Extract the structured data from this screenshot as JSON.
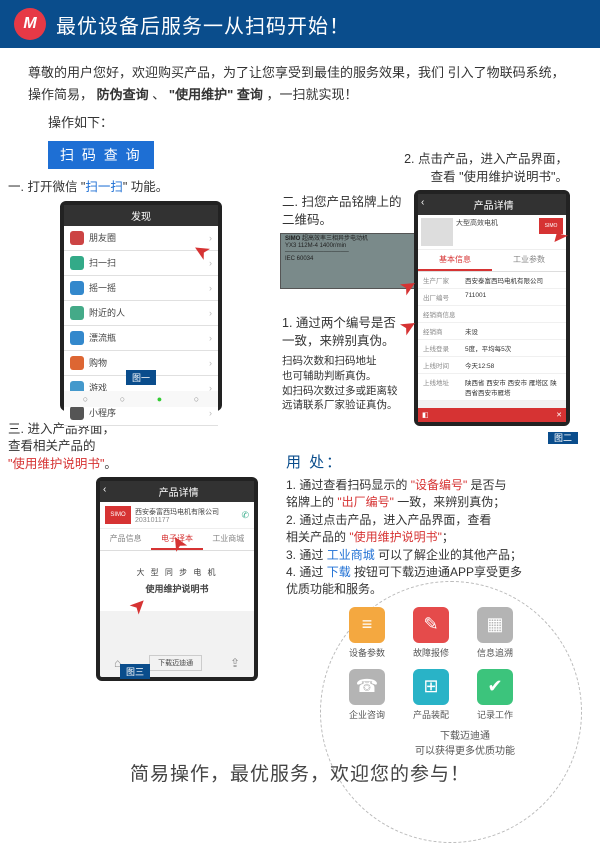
{
  "banner": {
    "logo_letter": "M",
    "title": "最优设备后服务一从扫码开始！"
  },
  "intro": {
    "line1_a": "尊敬的用户您好，欢迎购买产品，为了让您享受到最佳的服务效果，我们",
    "line1_b": "引入了物联码系统，操作简易，",
    "hl1": "防伪查询",
    "sep": "、",
    "hl2": "\"使用维护\" 查询",
    "tail": "，一扫就实现！",
    "follow": "操作如下："
  },
  "section_title": "扫 码 查 询",
  "step1": {
    "text_a": "一. 打开微信 \"",
    "text_b": "扫一扫",
    "text_c": "\" 功能。"
  },
  "phone1": {
    "header": "发现",
    "items": [
      {
        "label": "朋友圈",
        "color": "#c44"
      },
      {
        "label": "扫一扫",
        "color": "#3a8"
      },
      {
        "label": "摇一摇",
        "color": "#38c"
      },
      {
        "label": "附近的人",
        "color": "#4a8"
      },
      {
        "label": "漂流瓶",
        "color": "#38c"
      },
      {
        "label": "购物",
        "color": "#d63"
      },
      {
        "label": "游戏",
        "color": "#49c"
      },
      {
        "label": "小程序",
        "color": "#555"
      }
    ],
    "tag": "图一"
  },
  "step2": {
    "header_a": "2. 点击产品，进入产品界面，",
    "header_b": "查看 \"使用维护说明书\"。",
    "text_a": "二. 扫您产品铭牌上的",
    "text_b": "二维码。"
  },
  "nameplate": {
    "brand": "SIMO",
    "line1": "超高效率三相异步电动机",
    "line2": "YX3 112M-4  1400r/min",
    "line3": "IEC 60034"
  },
  "phone2": {
    "header": "产品详情",
    "title": "大型高效电机",
    "brand": "SIMO",
    "subtitle": "大型高效电动机",
    "tabA": "基本信息",
    "tabB": "工业参数",
    "rows": [
      {
        "k": "生产厂家",
        "v": "西安泰富西玛电机有限公司"
      },
      {
        "k": "出厂编号",
        "v": "711001"
      },
      {
        "k": "经销商信息",
        "v": ""
      },
      {
        "k": "经销商",
        "v": "未设"
      },
      {
        "k": "上线登录",
        "v": "5度，平均每5次"
      },
      {
        "k": "上线时间",
        "v": "今天12:58"
      },
      {
        "k": "上线地址",
        "v": "陕西省 西安市 西安市 雁塔区 陕西省西安市雁塔"
      }
    ],
    "tag": "图二"
  },
  "step2b": {
    "line1": "1. 通过两个编号是否",
    "line2": "一致，来辨别真伪。",
    "line3": "扫码次数和扫码地址",
    "line4": "也可辅助判断真伪。",
    "line5": "如扫码次数过多或距离较",
    "line6": "远请联系厂家验证真伪。"
  },
  "step3": {
    "text_a": "三. 进入产品界面，",
    "text_b": "查看相关产品的",
    "text_c": "\"使用维护说明书\"",
    "text_d": "。"
  },
  "phone3": {
    "header": "产品详情",
    "brand": "SIMO",
    "company": "西安泰富西玛电机有限公司",
    "code": "203101177",
    "tabs": [
      "产品信息",
      "电子译本",
      "工业商城"
    ],
    "doc_title": "大 型 同 步 电 机",
    "doc_sub": "使用维护说明书",
    "btn": "下载迈迪通",
    "tag": "图三"
  },
  "usage": {
    "title": "用 处：",
    "l1a": "1. 通过查看扫码显示的 ",
    "l1b": "\"设备编号\"",
    "l1c": " 是否与",
    "l1d": "铭牌上的 ",
    "l1e": "\"出厂编号\"",
    "l1f": " 一致，来辨别真伪；",
    "l2a": "2. 通过点击产品，进入产品界面，查看",
    "l2b": "相关产品的 ",
    "l2c": "\"使用维护说明书\"",
    "l2d": "；",
    "l3a": "3. 通过 ",
    "l3b": "工业商城",
    "l3c": " 可以了解企业的其他产品；",
    "l4a": "4. 通过 ",
    "l4b": "下载",
    "l4c": " 按钮可下载迈迪通APP享受更多",
    "l4d": "优质功能和服务。"
  },
  "icons": [
    {
      "label": "设备参数",
      "color": "#f4a840",
      "glyph": "≡"
    },
    {
      "label": "故障报修",
      "color": "#e54b4b",
      "glyph": "✎"
    },
    {
      "label": "信息追溯",
      "color": "#b4b4b4",
      "glyph": "▦"
    },
    {
      "label": "企业咨询",
      "color": "#b4b4b4",
      "glyph": "☎"
    },
    {
      "label": "产品装配",
      "color": "#29b3c7",
      "glyph": "⊞"
    },
    {
      "label": "记录工作",
      "color": "#3cc47c",
      "glyph": "✔"
    }
  ],
  "icon_footer": {
    "line1": "下载迈迪通",
    "line2": "可以获得更多优质功能"
  },
  "footer": "简易操作，最优服务，欢迎您的参与！"
}
